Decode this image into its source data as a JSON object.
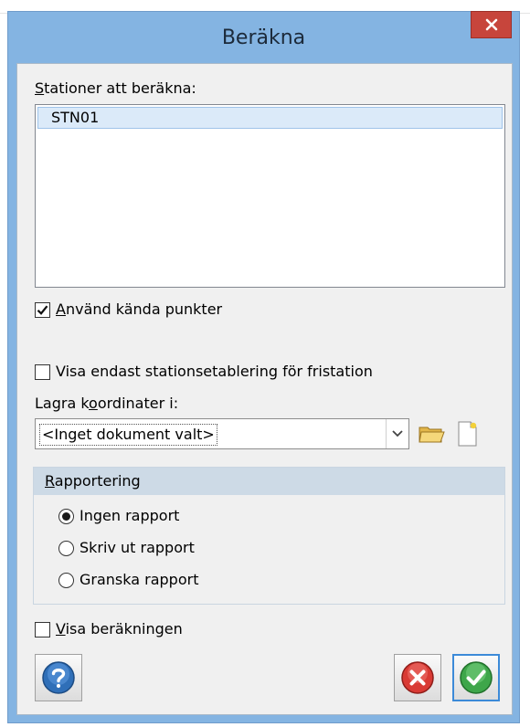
{
  "window": {
    "title": "Beräkna",
    "close_label": "×"
  },
  "stations": {
    "label_accesskey": "S",
    "label_rest": "tationer att beräkna:",
    "items": [
      "STN01"
    ]
  },
  "use_known_points": {
    "checked": true,
    "label_accesskey": "A",
    "label_rest": "nvänd kända punkter"
  },
  "only_free_station": {
    "checked": false,
    "label": "Visa endast stationsetablering för fristation"
  },
  "store_coords": {
    "label_pre": "Lagra k",
    "label_accesskey": "o",
    "label_post": "ordinater i:",
    "selected_value": "<Inget dokument valt>"
  },
  "reporting": {
    "header_accesskey": "R",
    "header_rest": "apportering",
    "options": [
      {
        "label": "Ingen rapport",
        "selected": true
      },
      {
        "label": "Skriv ut rapport",
        "selected": false
      },
      {
        "label": "Granska rapport",
        "selected": false
      }
    ]
  },
  "show_calculation": {
    "checked": false,
    "label_accesskey": "V",
    "label_rest": "isa beräkningen"
  },
  "icons": {
    "help": "help-icon",
    "open_folder": "folder-open-icon",
    "new_document": "new-document-icon",
    "cancel": "cancel-icon",
    "ok": "ok-check-icon"
  },
  "colors": {
    "frame": "#84b4e2",
    "close": "#c7453c",
    "selection": "#dbeaf9",
    "group_header": "#cddae6"
  }
}
